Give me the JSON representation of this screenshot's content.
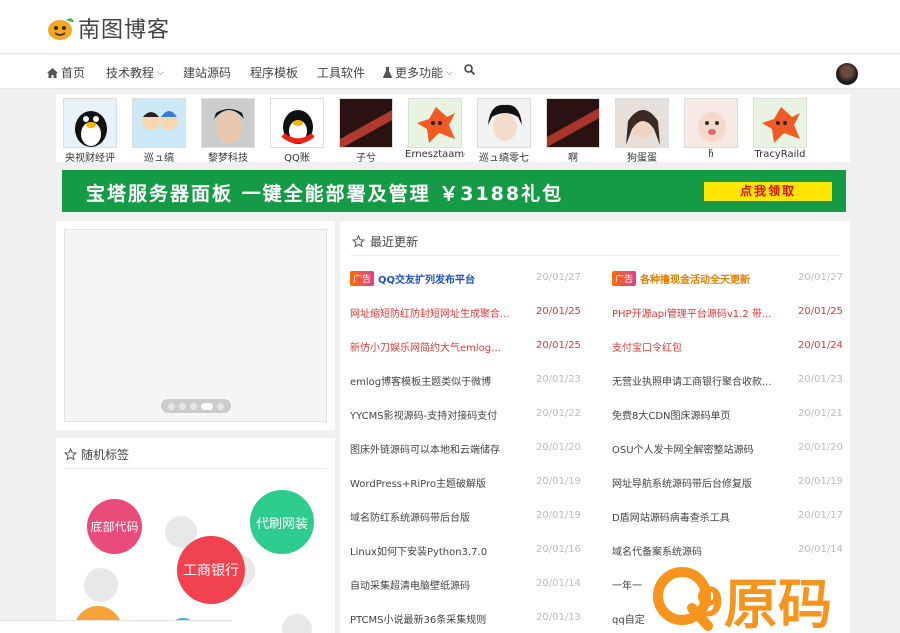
{
  "site": {
    "name": "南图博客"
  },
  "nav": {
    "items": [
      {
        "label": "首页",
        "icon": "home-icon"
      },
      {
        "label": "技术教程",
        "caret": true
      },
      {
        "label": "建站源码"
      },
      {
        "label": "程序模板"
      },
      {
        "label": "工具软件"
      },
      {
        "label": "更多功能",
        "caret": true,
        "icon": "flask-icon"
      }
    ]
  },
  "friends": [
    {
      "name": "央视财经评"
    },
    {
      "name": "巡ュ缟"
    },
    {
      "name": "黎梦科技"
    },
    {
      "name": "QQ账"
    },
    {
      "name": "子兮"
    },
    {
      "name": "Ernesztaamomo"
    },
    {
      "name": "巡ュ缟零七"
    },
    {
      "name": "啊"
    },
    {
      "name": "狗蛋蛋"
    },
    {
      "name": "ჩ"
    },
    {
      "name": "TracyRaild"
    }
  ],
  "banner": {
    "text": "宝塔服务器面板 一键全能部署及管理 ￥3188礼包",
    "button": "点我领取"
  },
  "tags": {
    "title": "随机标签",
    "items": [
      {
        "label": "底部代码",
        "color": "#e94b7b"
      },
      {
        "label": "代刷网装",
        "color": "#2ecc8e"
      },
      {
        "label": "工商银行",
        "color": "#f0424f"
      }
    ]
  },
  "news": {
    "title": "最近更新",
    "ad_label": "广告",
    "left": [
      {
        "title": "QQ交友扩列发布平台",
        "date": "20/01/27",
        "ad": true
      },
      {
        "title": "网址缩短防红防封短网址生成聚合...",
        "date": "20/01/25",
        "hot": true
      },
      {
        "title": "新仿小刀娱乐网简约大气emlog主...",
        "date": "20/01/25",
        "hot": true
      },
      {
        "title": "emlog博客模板主题类似于微博",
        "date": "20/01/23"
      },
      {
        "title": "YYCMS影视源码-支持对接码支付",
        "date": "20/01/22"
      },
      {
        "title": "图床外链源码可以本地和云端储存",
        "date": "20/01/20"
      },
      {
        "title": "WordPress+RiPro主题破解版",
        "date": "20/01/19"
      },
      {
        "title": "域名防红系统源码带后台版",
        "date": "20/01/19"
      },
      {
        "title": "Linux如何下安装Python3.7.0",
        "date": "20/01/16"
      },
      {
        "title": "自动采集超清电脑壁纸源码",
        "date": "20/01/14"
      },
      {
        "title": "PTCMS小说最新36条采集规则",
        "date": "20/01/13"
      }
    ],
    "right": [
      {
        "title": "各种撸现金活动全天更新",
        "date": "20/01/27",
        "ad": true
      },
      {
        "title": "PHP开源api管理平台源码v1.2 带...",
        "date": "20/01/25",
        "hot": true
      },
      {
        "title": "支付宝口令红包",
        "date": "20/01/24",
        "hot": true
      },
      {
        "title": "无营业执照申请工商银行聚合收款...",
        "date": "20/01/23"
      },
      {
        "title": "免费8大CDN图床源码单页",
        "date": "20/01/21"
      },
      {
        "title": "OSU个人发卡网全解密整站源码",
        "date": "20/01/20"
      },
      {
        "title": "网址导航系统源码带后台修复版",
        "date": "20/01/19"
      },
      {
        "title": "D盾网站源码病毒查杀工具",
        "date": "20/01/17"
      },
      {
        "title": "域名代备案系统源码",
        "date": "20/01/14"
      },
      {
        "title": "一年一",
        "date": ""
      },
      {
        "title": "qq自定",
        "date": ""
      }
    ]
  },
  "watermark": {
    "text": "原码",
    "digit": "9"
  },
  "colors": {
    "hot": "#e53935",
    "ad_left": "#1e50c8",
    "ad_right": "#e67e00",
    "banner": "#159b45"
  }
}
